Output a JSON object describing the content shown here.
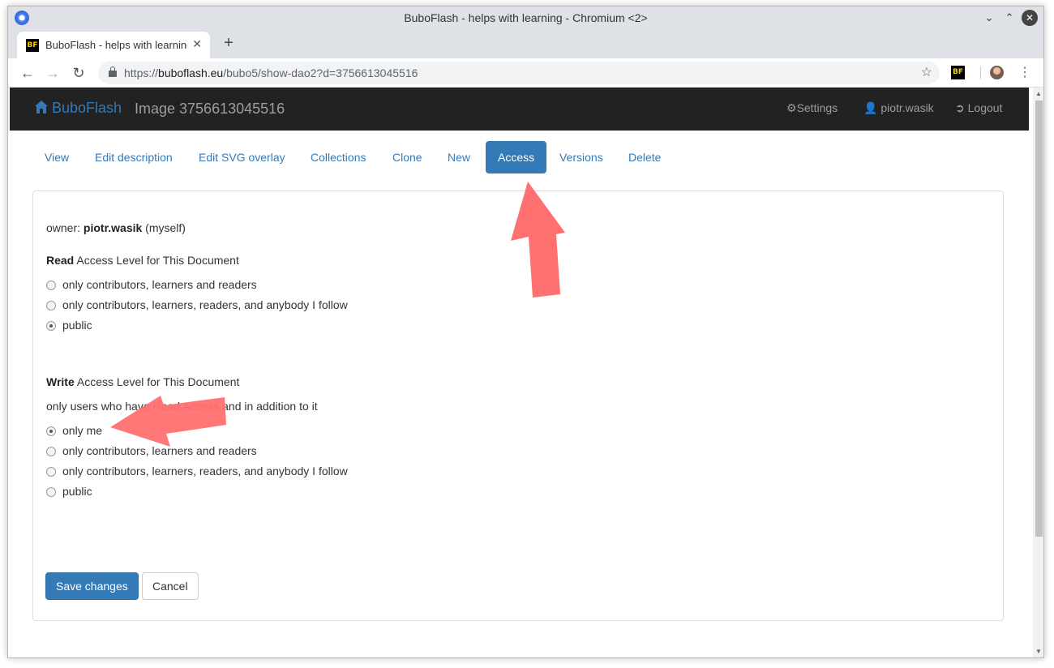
{
  "window": {
    "title": "BuboFlash - helps with learning - Chromium <2>"
  },
  "browser": {
    "tab_title": "BuboFlash - helps with learning",
    "tab_favicon": "BF",
    "url_scheme": "https://",
    "url_domain": "buboflash.eu",
    "url_path": "/bubo5/show-dao2?d=3756613045516",
    "extension_label": "BF"
  },
  "navbar": {
    "brand": "BuboFlash",
    "page_title": "Image 3756613045516",
    "settings": "Settings",
    "user": "piotr.wasik",
    "logout": "Logout"
  },
  "tabs": [
    "View",
    "Edit description",
    "Edit SVG overlay",
    "Collections",
    "Clone",
    "New",
    "Access",
    "Versions",
    "Delete"
  ],
  "active_tab": "Access",
  "form": {
    "owner_label": "owner:",
    "owner_name": "piotr.wasik",
    "owner_note": "(myself)",
    "read_heading_bold": "Read",
    "read_heading_rest": "Access Level for This Document",
    "read_options": [
      {
        "label": "only contributors, learners and readers",
        "checked": false
      },
      {
        "label": "only contributors, learners, readers, and anybody I follow",
        "checked": false
      },
      {
        "label": "public",
        "checked": true
      }
    ],
    "write_heading_bold": "Write",
    "write_heading_rest": "Access Level for This Document",
    "write_note": "only users who have Read Access and in addition to it",
    "write_options": [
      {
        "label": "only me",
        "checked": true
      },
      {
        "label": "only contributors, learners and readers",
        "checked": false
      },
      {
        "label": "only contributors, learners, readers, and anybody I follow",
        "checked": false
      },
      {
        "label": "public",
        "checked": false
      }
    ],
    "save_label": "Save changes",
    "cancel_label": "Cancel"
  },
  "colors": {
    "accent": "#337ab7",
    "navbar_bg": "#222222",
    "annotation_arrow": "#ff7070"
  }
}
